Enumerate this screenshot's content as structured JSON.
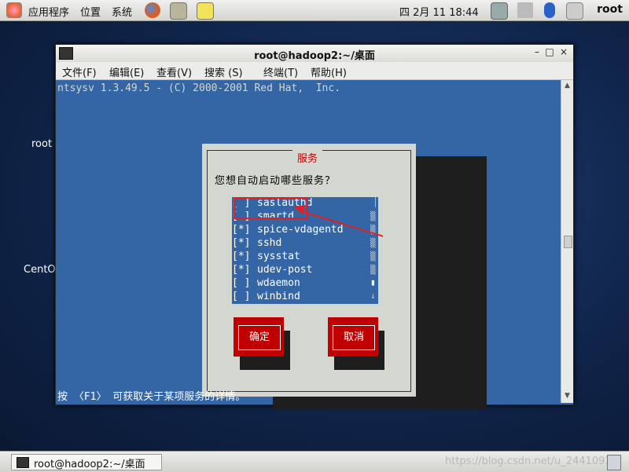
{
  "top_panel": {
    "menus": [
      "应用程序",
      "位置",
      "系统"
    ],
    "clock": "四 2月 11 18:44",
    "user": "root"
  },
  "desktop": {
    "icons": [
      "root",
      "CentO"
    ]
  },
  "window": {
    "title": "root@hadoop2:~/桌面",
    "controls": [
      "–",
      "□",
      "×"
    ],
    "menu": [
      "文件(F)",
      "编辑(E)",
      "查看(V)",
      "搜索 (S)",
      "终端(T)",
      "帮助(H)"
    ]
  },
  "terminal": {
    "header": "ntsysv 1.3.49.5 - (C) 2000-2001 Red Hat,  Inc.",
    "help": "按 〈F1〉 可获取关于某项服务的详情。"
  },
  "dialog": {
    "title": "服务",
    "question": "您想自动启动哪些服务？",
    "services": [
      {
        "mark": "[ ]",
        "name": "saslauthd"
      },
      {
        "mark": "[ ]",
        "name": "smartd"
      },
      {
        "mark": "[*]",
        "name": "spice-vdagentd"
      },
      {
        "mark": "[*]",
        "name": "sshd"
      },
      {
        "mark": "[*]",
        "name": "sysstat"
      },
      {
        "mark": "[*]",
        "name": "udev-post"
      },
      {
        "mark": "[ ]",
        "name": "wdaemon"
      },
      {
        "mark": "[ ]",
        "name": "winbind"
      }
    ],
    "ok_label": "确定",
    "cancel_label": "取消"
  },
  "taskbar": {
    "task_label": "root@hadoop2:~/桌面",
    "watermark": "https://blog.csdn.net/u_24410932"
  },
  "colors": {
    "terminal_bg": "#3465a4",
    "button_red": "#c00000",
    "dialog_gray": "#d3d7cf",
    "annotation": "#e02020"
  }
}
